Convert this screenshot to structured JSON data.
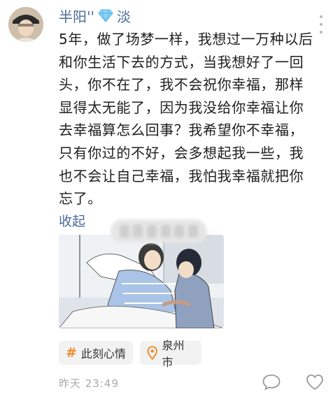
{
  "user": {
    "name_prefix": "半阳''",
    "name_suffix": "淡",
    "badge_icon": "diamond-icon",
    "name_color": "#4a6b98"
  },
  "post": {
    "text": "5年，做了场梦一样，我想过一万种以后和你生活下去的方式，当我想好了一回头，你不在了，我不会祝你幸福，那样显得太无能了，因为我没给你幸福让你去幸福算怎么回事？我希望你不幸福，只有你过的不好，会多想起我一些，我也不会让自己幸福，我怕我幸福就把你忘了。",
    "collapse_label": "收起"
  },
  "tags": {
    "topic_label": "此刻心情",
    "topic_icon": "hash-icon",
    "location_label": "泉州市",
    "location_icon": "location-pin-icon"
  },
  "footer": {
    "time": "昨天 23:49",
    "comment_icon": "comment-icon",
    "like_icon": "heart-icon"
  }
}
